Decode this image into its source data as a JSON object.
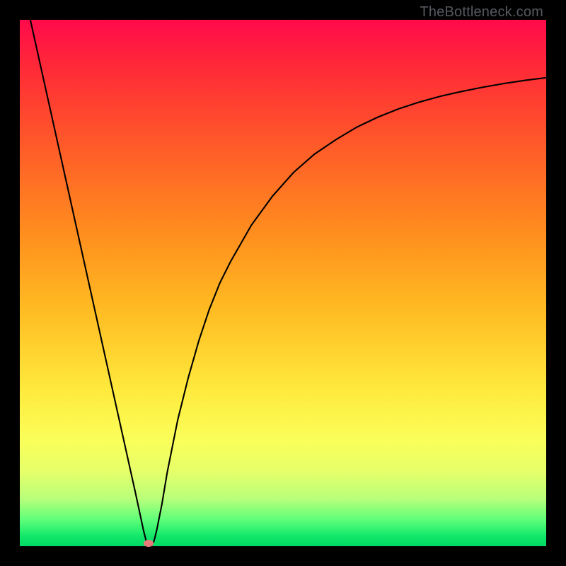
{
  "watermark": "TheBottleneck.com",
  "chart_data": {
    "type": "line",
    "title": "",
    "xlabel": "",
    "ylabel": "",
    "xlim": [
      0,
      100
    ],
    "ylim": [
      0,
      100
    ],
    "series": [
      {
        "name": "curve",
        "x": [
          2,
          4,
          6,
          8,
          10,
          12,
          14,
          16,
          18,
          20,
          22,
          23.5,
          24,
          24.5,
          25,
          25.5,
          26,
          27,
          28,
          30,
          32,
          34,
          36,
          38,
          40,
          44,
          48,
          52,
          56,
          60,
          64,
          68,
          72,
          76,
          80,
          84,
          88,
          92,
          96,
          100
        ],
        "y": [
          100,
          91,
          82,
          73,
          64,
          55,
          46,
          37,
          28,
          19,
          10,
          3,
          1,
          0,
          0,
          1,
          3,
          8,
          14,
          24,
          32,
          39,
          45,
          50,
          54,
          61,
          66.5,
          71,
          74.5,
          77.2,
          79.6,
          81.5,
          83.1,
          84.4,
          85.5,
          86.4,
          87.2,
          87.9,
          88.5,
          89
        ]
      }
    ],
    "marker": {
      "x": 24.5,
      "y": 0.5
    },
    "gradient_stops": [
      {
        "pct": 0,
        "color": "#ff0a4a"
      },
      {
        "pct": 10,
        "color": "#ff2d36"
      },
      {
        "pct": 25,
        "color": "#ff5e28"
      },
      {
        "pct": 40,
        "color": "#ff8c1e"
      },
      {
        "pct": 55,
        "color": "#ffbb22"
      },
      {
        "pct": 70,
        "color": "#ffe93c"
      },
      {
        "pct": 80,
        "color": "#faff5a"
      },
      {
        "pct": 86,
        "color": "#e5ff6a"
      },
      {
        "pct": 91,
        "color": "#b8ff7a"
      },
      {
        "pct": 95,
        "color": "#5eff7a"
      },
      {
        "pct": 98,
        "color": "#14e86a"
      },
      {
        "pct": 100,
        "color": "#00d864"
      }
    ]
  }
}
